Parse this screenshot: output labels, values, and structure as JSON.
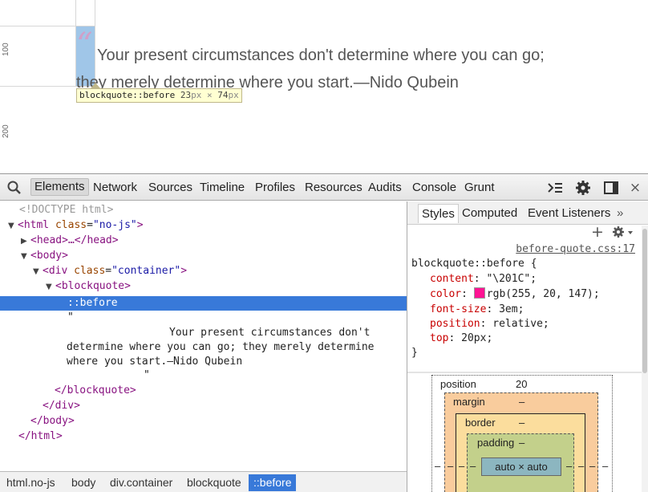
{
  "preview": {
    "ruler_marks": [
      "100",
      "200"
    ],
    "quote_open": "“",
    "quote_line1": "Your present circumstances don't determine where you can go;",
    "quote_line2": "they merely determine where you start.—Nido Qubein",
    "tooltip": {
      "selector": "blockquote::before",
      "width": "23",
      "height": "74",
      "unit": "px",
      "times": "×"
    }
  },
  "toolbar": {
    "tabs": [
      "Elements",
      "Network",
      "Sources",
      "Timeline",
      "Profiles",
      "Resources",
      "Audits",
      "Console",
      "Grunt"
    ],
    "active_tab": "Elements",
    "icons": [
      "inspect-icon",
      "console-drawer-icon",
      "gear-icon",
      "dock-icon",
      "close-icon"
    ]
  },
  "tree": {
    "doctype": "<!DOCTYPE html>",
    "html_open": "<html",
    "html_attr": "class",
    "html_val": "\"no-js\"",
    "html_close_bracket": ">",
    "head": "<head>…</head>",
    "body_open": "<body>",
    "div_open": "<div",
    "div_attr": "class",
    "div_val": "\"container\"",
    "div_close_bracket": ">",
    "blockquote_open": "<blockquote>",
    "before": "::before",
    "text_quote_open": "\"",
    "text_line1": "Your present circumstances don't",
    "text_line2": "determine where you can go; they merely determine",
    "text_line3": "where you start.—Nido Qubein",
    "text_quote_close": "\"",
    "blockquote_close": "</blockquote>",
    "div_close": "</div>",
    "body_close": "</body>",
    "html_close": "</html>"
  },
  "breadcrumbs": [
    "html.no-js",
    "body",
    "div.container",
    "blockquote",
    "::before"
  ],
  "sidebar": {
    "tabs": [
      "Styles",
      "Computed",
      "Event Listeners"
    ],
    "more": "»",
    "add_icon": "+",
    "source": "before-quote.css:17",
    "selector": "blockquote::before {",
    "props": [
      {
        "name": "content",
        "value": "\"\\201C\";"
      },
      {
        "name": "color",
        "value": "rgb(255, 20, 147);"
      },
      {
        "name": "font-size",
        "value": "3em;"
      },
      {
        "name": "position",
        "value": "relative;"
      },
      {
        "name": "top",
        "value": "20px;"
      }
    ],
    "rule_close": "}",
    "swatch_color": "#ff1493"
  },
  "boxmodel": {
    "position_label": "position",
    "position_top": "20",
    "margin_label": "margin",
    "margin_value": "–",
    "border_label": "border",
    "border_value": "–",
    "padding_label": "padding",
    "padding_value": "–",
    "content": "auto × auto",
    "side_dash": "–"
  }
}
